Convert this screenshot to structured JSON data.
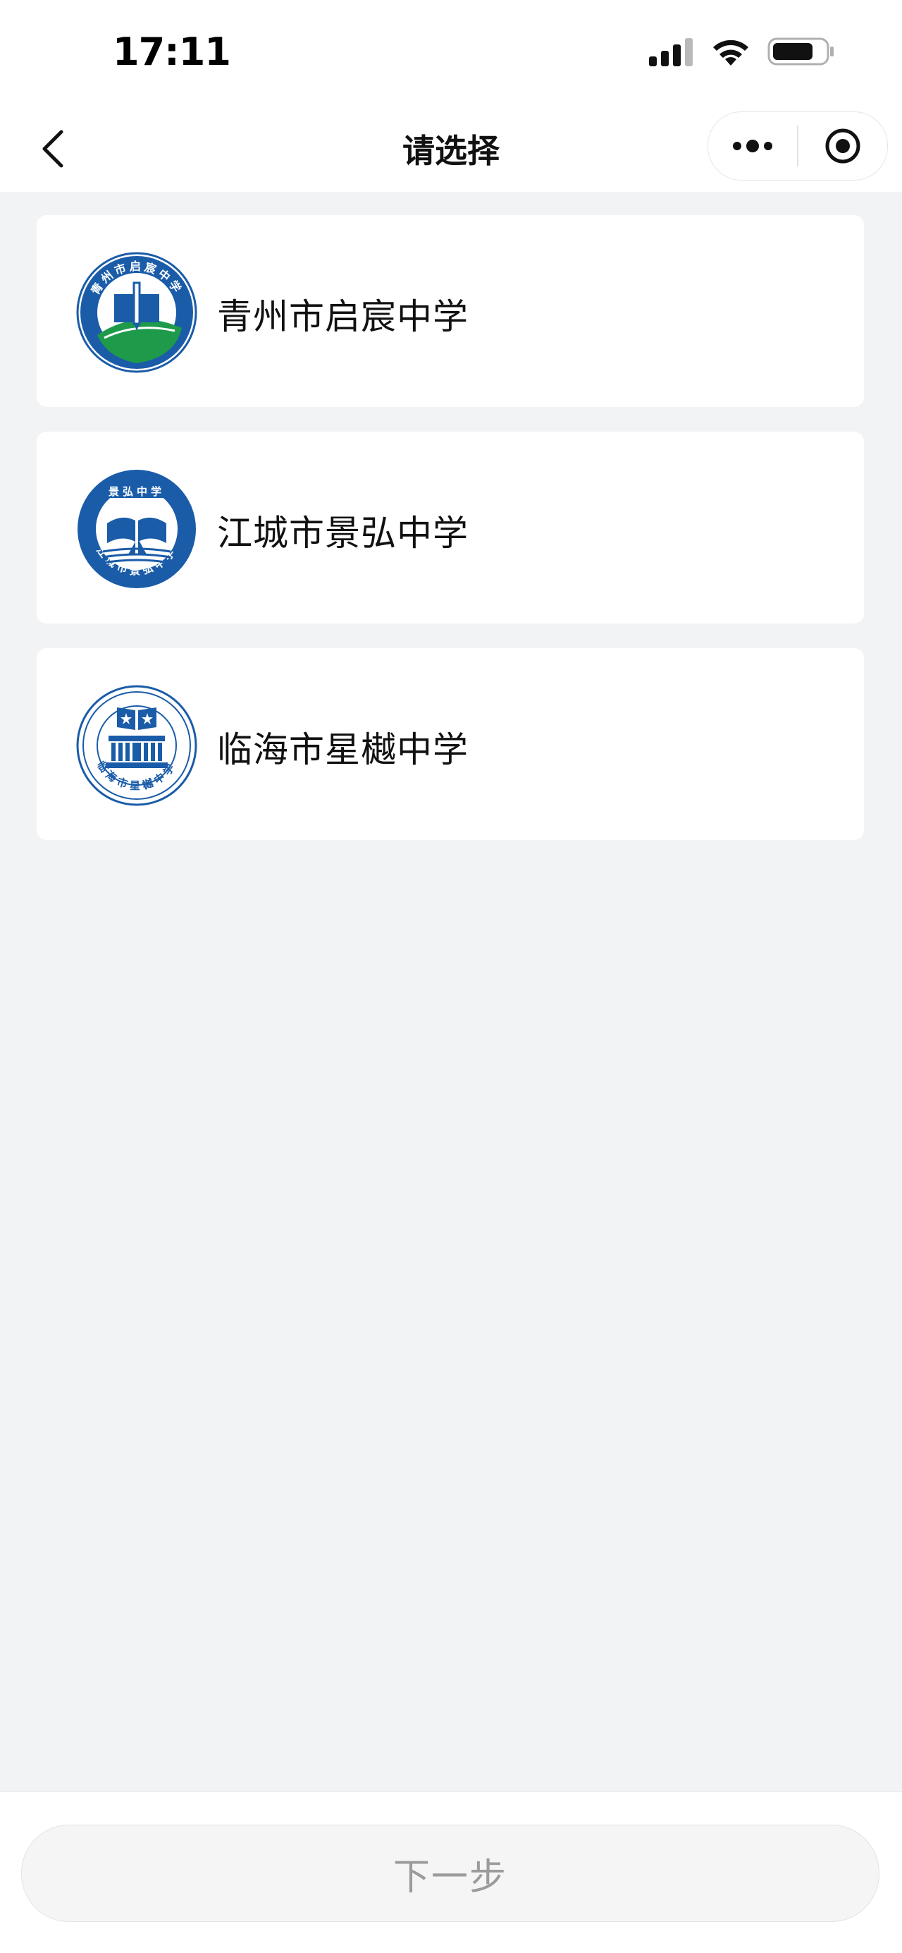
{
  "status_bar": {
    "time": "17:11",
    "icons": [
      "signal-icon",
      "wifi-icon",
      "battery-icon"
    ]
  },
  "navbar": {
    "title": "请选择",
    "back_icon": "chevron-left-icon",
    "more_icon": "more-dots-icon",
    "close_icon": "target-icon"
  },
  "schools": [
    {
      "name": "青州市启宸中学",
      "logo_text": "青州市启宸中学",
      "logo_icon": "school-logo-book-pen"
    },
    {
      "name": "江城市景弘中学",
      "logo_text_top": "景弘中学",
      "logo_text_bottom": "江城市景弘中学",
      "logo_icon": "school-logo-book-sailboat"
    },
    {
      "name": "临海市星樾中学",
      "logo_text_bottom": "临海市星樾中学",
      "logo_icon": "school-logo-book-building"
    }
  ],
  "footer": {
    "next_label": "下一步"
  },
  "colors": {
    "primary_blue": "#1a5ca8",
    "green": "#1f9a4a",
    "background": "#f2f3f5",
    "card": "#ffffff",
    "disabled_text": "#9b9b9b"
  }
}
